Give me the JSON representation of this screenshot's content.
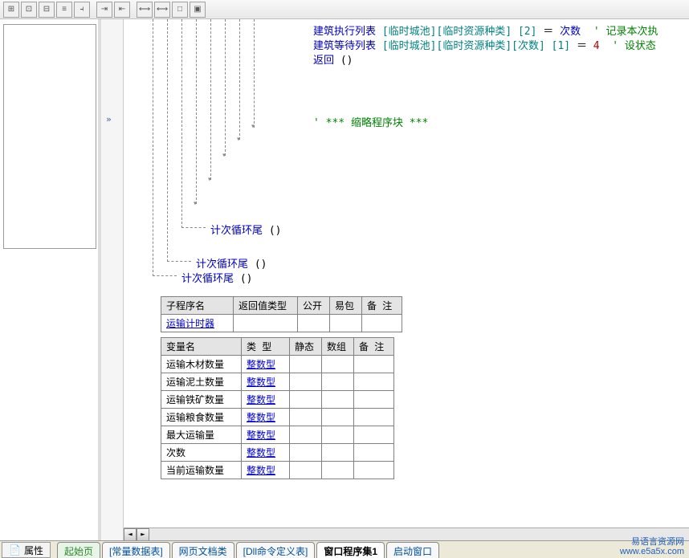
{
  "toolbar_icons": [
    "⊞",
    "⊡",
    "⊟",
    "≡",
    "⫞",
    "⇥",
    "⇤",
    "⟷",
    "⟷",
    "□",
    "▣"
  ],
  "code": {
    "line1_a": "建筑执行列表",
    "line1_b": "[临时城池][临时资源种类]",
    "line1_c": "[2]",
    "line1_d": "＝",
    "line1_e": "次数",
    "line1_f": "' 记录本次执",
    "line2_a": "建筑等待列表",
    "line2_b": "[临时城池][临时资源种类][次数]",
    "line2_c": "[1]",
    "line2_d": "＝",
    "line2_e": "4",
    "line2_f": "' 设状态",
    "line3": "返回",
    "paren": "()",
    "comment_block": "' *** 缩略程序块 ***",
    "loop_end1": "计次循环尾",
    "loop_end2": "计次循环尾",
    "loop_end3": "计次循环尾"
  },
  "table1": {
    "headers": [
      "子程序名",
      "返回值类型",
      "公开",
      "易包",
      "备 注"
    ],
    "rows": [
      [
        "运输计时器",
        "",
        "",
        "",
        ""
      ]
    ]
  },
  "table2": {
    "headers": [
      "变量名",
      "类 型",
      "静态",
      "数组",
      "备 注"
    ],
    "rows": [
      [
        "运输木材数量",
        "整数型",
        "",
        "",
        ""
      ],
      [
        "运输泥土数量",
        "整数型",
        "",
        "",
        ""
      ],
      [
        "运输铁矿数量",
        "整数型",
        "",
        "",
        ""
      ],
      [
        "运输粮食数量",
        "整数型",
        "",
        "",
        ""
      ],
      [
        "最大运输量",
        "整数型",
        "",
        "",
        ""
      ],
      [
        "次数",
        "整数型",
        "",
        "",
        ""
      ],
      [
        "当前运输数量",
        "整数型",
        "",
        "",
        ""
      ]
    ]
  },
  "prop_button": "属性",
  "tabs": {
    "start": "起始页",
    "const_table": "[常量数据表]",
    "web_docs": "网页文档类",
    "dll_cmd": "[Dll命令定义表]",
    "window_proc": "窗口程序集1",
    "startup_win": "启动窗口"
  },
  "watermark": {
    "line1": "易语言资源网",
    "line2": "www.e5a5x.com"
  }
}
